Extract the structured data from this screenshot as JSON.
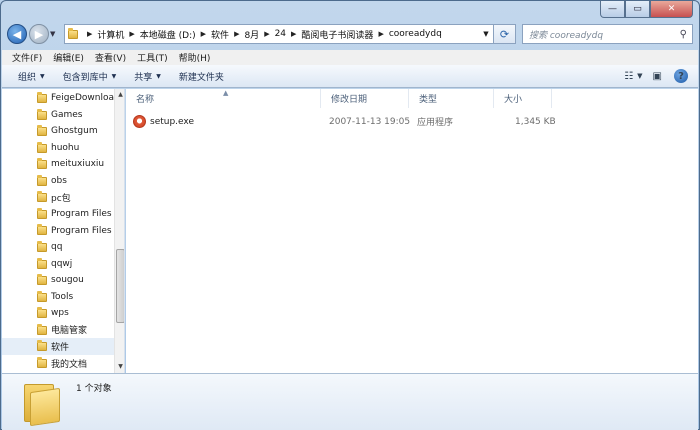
{
  "window": {
    "caption_buttons": [
      "minimize",
      "maximize",
      "close"
    ]
  },
  "nav": {
    "breadcrumbs": [
      "计算机",
      "本地磁盘 (D:)",
      "软件",
      "8月",
      "24",
      "酷阅电子书阅读器",
      "cooreadydq"
    ],
    "search_placeholder": "搜索 cooreadydq"
  },
  "menu": [
    "文件(F)",
    "编辑(E)",
    "查看(V)",
    "工具(T)",
    "帮助(H)"
  ],
  "commands": {
    "organize": "组织",
    "include": "包含到库中",
    "share": "共享",
    "new_folder": "新建文件夹"
  },
  "tree": [
    {
      "label": "FeigeDownloa",
      "selected": false
    },
    {
      "label": "Games",
      "selected": false
    },
    {
      "label": "Ghostgum",
      "selected": false
    },
    {
      "label": "huohu",
      "selected": false
    },
    {
      "label": "meituxiuxiu",
      "selected": false
    },
    {
      "label": "obs",
      "selected": false
    },
    {
      "label": "pc包",
      "selected": false
    },
    {
      "label": "Program Files",
      "selected": false
    },
    {
      "label": "Program Files",
      "selected": false
    },
    {
      "label": "qq",
      "selected": false
    },
    {
      "label": "qqwj",
      "selected": false
    },
    {
      "label": "sougou",
      "selected": false
    },
    {
      "label": "Tools",
      "selected": false
    },
    {
      "label": "wps",
      "selected": false
    },
    {
      "label": "电脑管家",
      "selected": false
    },
    {
      "label": "软件",
      "selected": true
    },
    {
      "label": "我的文档",
      "selected": false
    }
  ],
  "columns": {
    "name": "名称",
    "modified": "修改日期",
    "type": "类型",
    "size": "大小"
  },
  "files": [
    {
      "name": "setup.exe",
      "modified": "2007-11-13 19:05",
      "type": "应用程序",
      "size": "1,345 KB",
      "icon": "installer-icon"
    }
  ],
  "details": {
    "count": "1 个对象"
  },
  "colors": {
    "accent": "#2a63a8",
    "folder": "#e6bc4a",
    "selected": "#e5eef8"
  }
}
